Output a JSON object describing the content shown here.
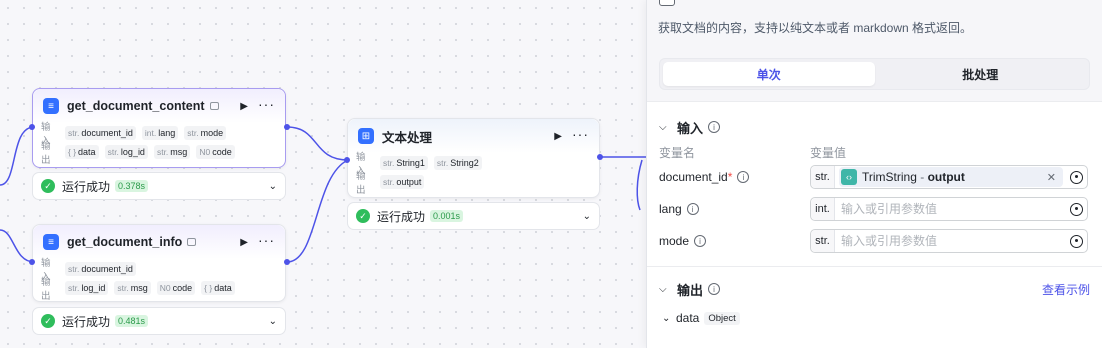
{
  "nodes": {
    "get_document_content": {
      "title": "get_document_content",
      "in_label": "输入",
      "out_label": "输出",
      "inputs": [
        {
          "type": "str.",
          "name": "document_id"
        },
        {
          "type": "int.",
          "name": "lang"
        },
        {
          "type": "str.",
          "name": "mode"
        }
      ],
      "outputs": [
        {
          "type": "{ }",
          "name": "data"
        },
        {
          "type": "str.",
          "name": "log_id"
        },
        {
          "type": "str.",
          "name": "msg"
        },
        {
          "type": "N0",
          "name": "code"
        }
      ],
      "status": "运行成功",
      "time": "0.378s"
    },
    "get_document_info": {
      "title": "get_document_info",
      "in_label": "输入",
      "out_label": "输出",
      "inputs": [
        {
          "type": "str.",
          "name": "document_id"
        }
      ],
      "outputs": [
        {
          "type": "str.",
          "name": "log_id"
        },
        {
          "type": "str.",
          "name": "msg"
        },
        {
          "type": "N0",
          "name": "code"
        },
        {
          "type": "{ }",
          "name": "data"
        }
      ],
      "status": "运行成功",
      "time": "0.481s"
    },
    "text_process": {
      "title": "文本处理",
      "in_label": "输入",
      "out_label": "输出",
      "inputs": [
        {
          "type": "str.",
          "name": "String1"
        },
        {
          "type": "str.",
          "name": "String2"
        }
      ],
      "outputs": [
        {
          "type": "str.",
          "name": "output"
        }
      ],
      "status": "运行成功",
      "time": "0.001s"
    }
  },
  "panel": {
    "description": "获取文档的内容，支持以纯文本或者 markdown 格式返回。",
    "tabs": [
      {
        "label": "单次",
        "active": true
      },
      {
        "label": "批处理",
        "active": false
      }
    ],
    "input_section": {
      "title": "输入",
      "col_name": "变量名",
      "col_value": "变量值",
      "fields": [
        {
          "name": "document_id",
          "required": "*",
          "type": "str.",
          "ref_name": "TrimString",
          "ref_sep": " - ",
          "ref_field": "output"
        },
        {
          "name": "lang",
          "type": "int.",
          "placeholder": "输入或引用参数值"
        },
        {
          "name": "mode",
          "type": "str.",
          "placeholder": "输入或引用参数值"
        }
      ]
    },
    "output_section": {
      "title": "输出",
      "link": "查看示例",
      "items": [
        {
          "name": "data",
          "type": "Object"
        }
      ]
    }
  },
  "colors": {
    "accent": "#4d53e8",
    "success": "#2fbd5c",
    "edge": "#4d53e8"
  }
}
